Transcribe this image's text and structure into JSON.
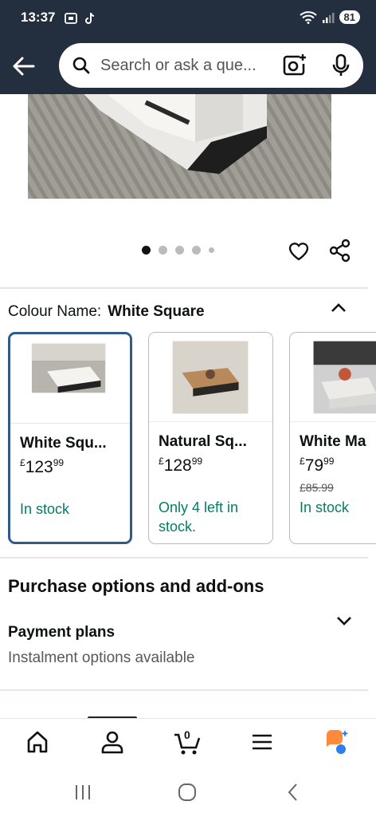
{
  "status_bar": {
    "time": "13:37",
    "battery": "81"
  },
  "search": {
    "placeholder": "Search or ask a que..."
  },
  "gallery": {
    "dot_count": 5,
    "active_dot": 1
  },
  "colour": {
    "label": "Colour Name:",
    "value": "White Square"
  },
  "variants": [
    {
      "title": "White Squ...",
      "currency": "£",
      "price_whole": "123",
      "price_fraction": "99",
      "was_price": "",
      "stock": "In stock",
      "stock_line2": ""
    },
    {
      "title": "Natural Sq...",
      "currency": "£",
      "price_whole": "128",
      "price_fraction": "99",
      "was_price": "",
      "stock": "Only 4 left in",
      "stock_line2": "stock."
    },
    {
      "title": "White Ma",
      "currency": "£",
      "price_whole": "79",
      "price_fraction": "99",
      "was_price": "£85.99",
      "stock": "In stock",
      "stock_line2": ""
    }
  ],
  "purchase_options": {
    "title": "Purchase options and add-ons",
    "payment_title": "Payment plans",
    "payment_sub": "Instalment options available"
  },
  "bottom_nav": {
    "cart_count": "0"
  },
  "colors": {
    "header_bg": "#232f3e",
    "selected_border": "#2d5b8a",
    "stock_green": "#067d62"
  }
}
